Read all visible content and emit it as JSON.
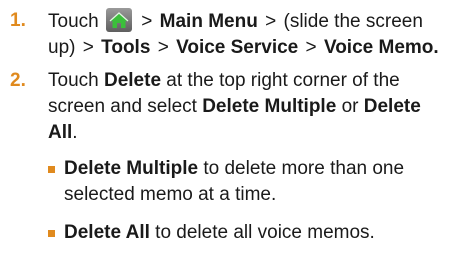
{
  "steps": [
    {
      "number": "1.",
      "touch": "Touch",
      "gt1": ">",
      "main_menu": "Main Menu",
      "gt2": ">",
      "slide_note": "(slide the screen up)",
      "gt3": ">",
      "tools": "Tools",
      "gt4": ">",
      "voice_service": "Voice Service",
      "gt5": ">",
      "voice_memo": "Voice Memo."
    },
    {
      "number": "2.",
      "touch": "Touch",
      "delete": "Delete",
      "mid1": "at the top right corner of the screen and select",
      "delete_multiple": "Delete Multiple",
      "or": "or",
      "delete_all": "Delete All",
      "end": "."
    }
  ],
  "bullets": [
    {
      "term": "Delete Multiple",
      "desc": "to delete more than one selected memo at a time."
    },
    {
      "term": "Delete All",
      "desc": "to delete all voice memos."
    }
  ],
  "icons": {
    "home": "home-icon"
  },
  "colors": {
    "accent": "#e08a1e",
    "icon_bg": "#7a7a7a",
    "icon_fg": "#3bbf3b"
  }
}
